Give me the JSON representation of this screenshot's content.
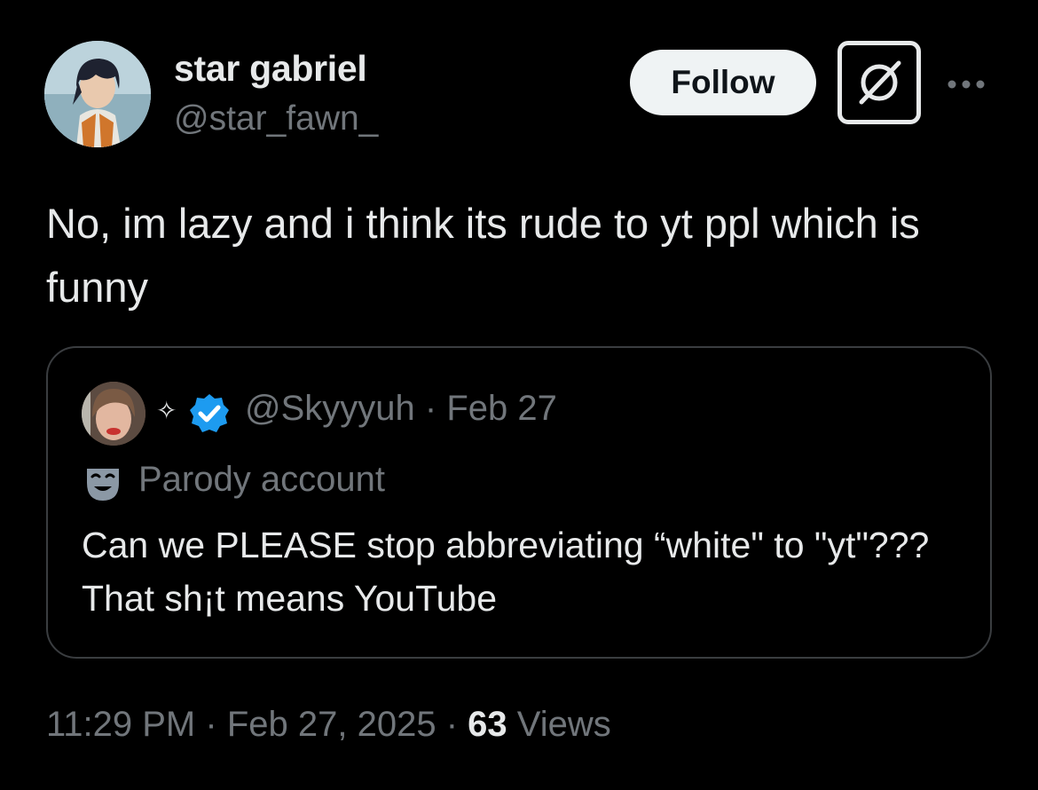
{
  "author": {
    "display_name": "star gabriel",
    "handle": "@star_fawn_",
    "avatar_icon": "user-avatar"
  },
  "actions": {
    "follow_label": "Follow",
    "grok_icon": "grok-icon",
    "more_icon": "more-dots-icon"
  },
  "tweet": {
    "text": "No, im lazy and i think its rude to yt ppl which is funny"
  },
  "quote": {
    "name_prefix": "✧",
    "verified_icon": "verified-check-icon",
    "handle": "@Skyyyuh",
    "separator": "·",
    "date": "Feb 27",
    "parody_icon": "theater-mask-icon",
    "parody_label": "Parody account",
    "text": "Can we PLEASE stop abbreviating “white\" to \"yt\"??? That sh¡t means YouTube"
  },
  "meta": {
    "time": "11:29 PM",
    "separator": "·",
    "date": "Feb 27, 2025",
    "views_count": "63",
    "views_label": "Views"
  },
  "colors": {
    "background": "#000000",
    "primary_text": "#e7e9ea",
    "secondary_text": "#71767b",
    "verified_blue": "#1d9bf0",
    "border": "#3a3d40"
  }
}
